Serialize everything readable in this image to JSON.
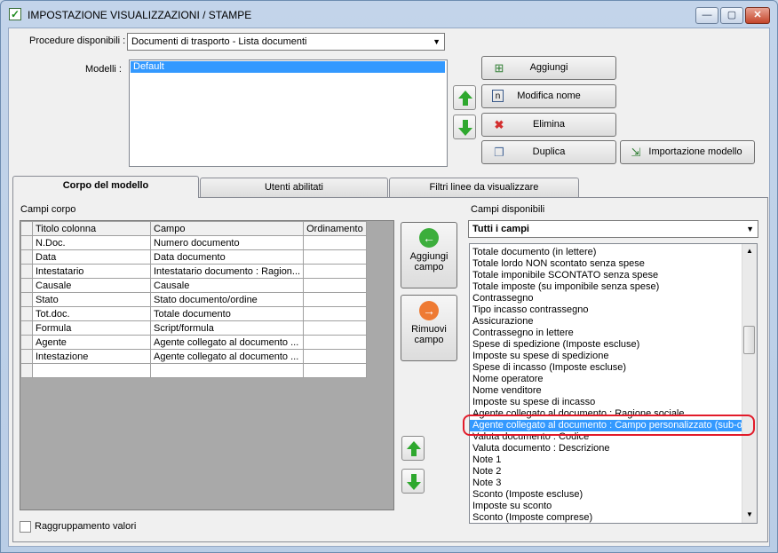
{
  "window": {
    "title": "IMPOSTAZIONE VISUALIZZAZIONI / STAMPE",
    "minimize": "—",
    "maximize": "▢",
    "close": "✕"
  },
  "procedure": {
    "label": "Procedure disponibili :",
    "value": "Documenti di trasporto - Lista documenti"
  },
  "modelli": {
    "label": "Modelli :",
    "items": [
      "Default"
    ]
  },
  "buttons": {
    "aggiungi": "Aggiungi",
    "modifica_nome": "Modifica nome",
    "elimina": "Elimina",
    "duplica": "Duplica",
    "importazione": "Importazione modello"
  },
  "tabs": [
    "Corpo del modello",
    "Utenti abilitati",
    "Filtri linee da visualizzare"
  ],
  "corpo": {
    "label": "Campi corpo",
    "columns": [
      "Titolo colonna",
      "Campo",
      "Ordinamento"
    ],
    "rows": [
      [
        "N.Doc.",
        "Numero documento",
        ""
      ],
      [
        "Data",
        "Data documento",
        ""
      ],
      [
        "Intestatario",
        "Intestatario documento : Ragion...",
        ""
      ],
      [
        "Causale",
        "Causale",
        ""
      ],
      [
        "Stato",
        "Stato documento/ordine",
        ""
      ],
      [
        "Tot.doc.",
        "Totale documento",
        ""
      ],
      [
        "Formula",
        "Script/formula",
        ""
      ],
      [
        "Agente",
        "Agente collegato al documento ...",
        ""
      ],
      [
        "Intestazione",
        "Agente collegato al documento ...",
        ""
      ],
      [
        "",
        "",
        ""
      ]
    ]
  },
  "middle": {
    "add_line1": "Aggiungi",
    "add_line2": "campo",
    "remove_line1": "Rimuovi",
    "remove_line2": "campo"
  },
  "disponibili": {
    "label": "Campi disponibili",
    "filter": "Tutti i campi",
    "items": [
      "Totale documento (in lettere)",
      "Totale lordo NON scontato senza spese",
      "Totale imponibile SCONTATO senza spese",
      "Totale imposte (su imponibile senza spese)",
      "Contrassegno",
      "Tipo incasso contrassegno",
      "Assicurazione",
      "Contrassegno in lettere",
      "Spese di spedizione (Imposte escluse)",
      "Imposte su spese di spedizione",
      "Spese di incasso (Imposte escluse)",
      "Nome operatore",
      "Nome venditore",
      "Imposte su spese di incasso",
      "Agente collegato al documento : Ragione sociale",
      "Agente collegato al documento : Campo personalizzato (sub-opz",
      "Valuta documento : Codice",
      "Valuta documento : Descrizione",
      "Note 1",
      "Note 2",
      "Note 3",
      "Sconto (Imposte escluse)",
      "Imposte su sconto",
      "Sconto (Imposte comprese)"
    ],
    "selected_index": 15
  },
  "raggruppamento": {
    "label": "Raggruppamento valori",
    "checked": false
  }
}
